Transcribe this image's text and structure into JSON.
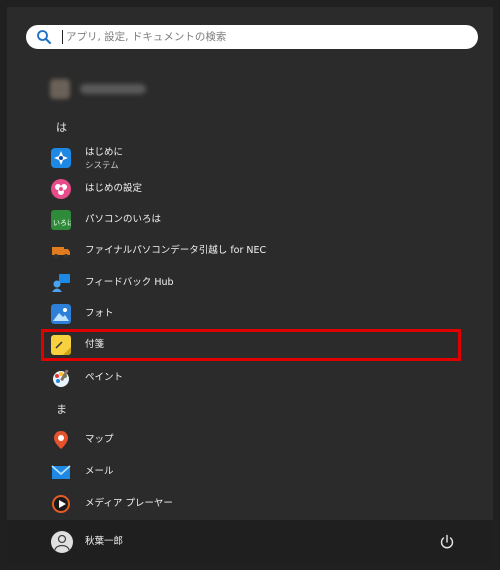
{
  "search": {
    "placeholder": "アプリ, 設定, ドキュメントの検索",
    "icon": "search-icon"
  },
  "groups": [
    {
      "letter": "は"
    },
    {
      "letter": "ま"
    }
  ],
  "apps": [
    {
      "label": "はじめに",
      "sub": "システム",
      "icon": "get-started-icon"
    },
    {
      "label": "はじめの設定",
      "icon": "initial-setup-icon"
    },
    {
      "label": "パソコンのいろは",
      "icon": "iroha-icon"
    },
    {
      "label": "ファイナルパソコンデータ引越し for NEC",
      "icon": "data-transfer-truck-icon"
    },
    {
      "label": "フィードバック Hub",
      "icon": "feedback-hub-icon"
    },
    {
      "label": "フォト",
      "icon": "photos-icon"
    },
    {
      "label": "付箋",
      "icon": "sticky-notes-icon"
    },
    {
      "label": "ペイント",
      "icon": "paint-icon"
    },
    {
      "label": "マップ",
      "icon": "maps-icon"
    },
    {
      "label": "メール",
      "icon": "mail-icon"
    },
    {
      "label": "メディア プレーヤー",
      "icon": "media-player-icon"
    }
  ],
  "footer": {
    "user_name": "秋葉一郎",
    "power_icon": "power-icon",
    "avatar_icon": "user-avatar-icon"
  },
  "colors": {
    "highlight": "#e00000",
    "background": "#2b2b2b",
    "footer": "#1f1f1f"
  }
}
